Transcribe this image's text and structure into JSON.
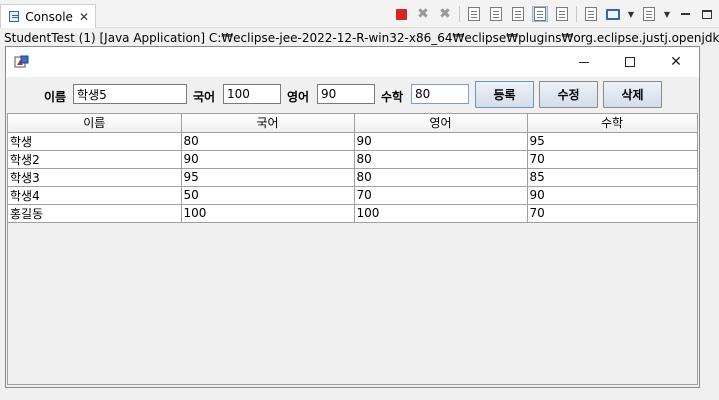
{
  "console": {
    "tab_label": "Console",
    "launch_text": "StudentTest (1) [Java Application] C:₩eclipse-jee-2022-12-R-win32-x86_64₩eclipse₩plugins₩org.eclipse.justj.openjdk.hotspot.jre.full",
    "toolbar_icons": [
      "stop-icon",
      "remove-launch-icon",
      "remove-all-icon",
      "clear-console-icon",
      "scroll-lock-icon",
      "word-wrap-icon",
      "pin-console-icon",
      "show-console-icon",
      "open-console-icon",
      "display-console-icon",
      "new-console-icon",
      "minimize-icon",
      "maximize-icon"
    ]
  },
  "window": {
    "controls": {
      "minimize": "minimize",
      "maximize": "maximize",
      "close": "✕"
    }
  },
  "form": {
    "name_label": "이름",
    "name_value": "학생5",
    "korean_label": "국어",
    "korean_value": "100",
    "english_label": "영어",
    "english_value": "90",
    "math_label": "수학",
    "math_value": "80",
    "register_label": "등록",
    "edit_label": "수정",
    "delete_label": "삭제"
  },
  "table": {
    "columns": [
      "이름",
      "국어",
      "영어",
      "수학"
    ],
    "rows": [
      [
        "학생",
        "80",
        "90",
        "95"
      ],
      [
        "학생2",
        "90",
        "80",
        "70"
      ],
      [
        "학생3",
        "95",
        "80",
        "85"
      ],
      [
        "학생4",
        "50",
        "70",
        "90"
      ],
      [
        "홍길동",
        "100",
        "100",
        "70"
      ]
    ]
  }
}
